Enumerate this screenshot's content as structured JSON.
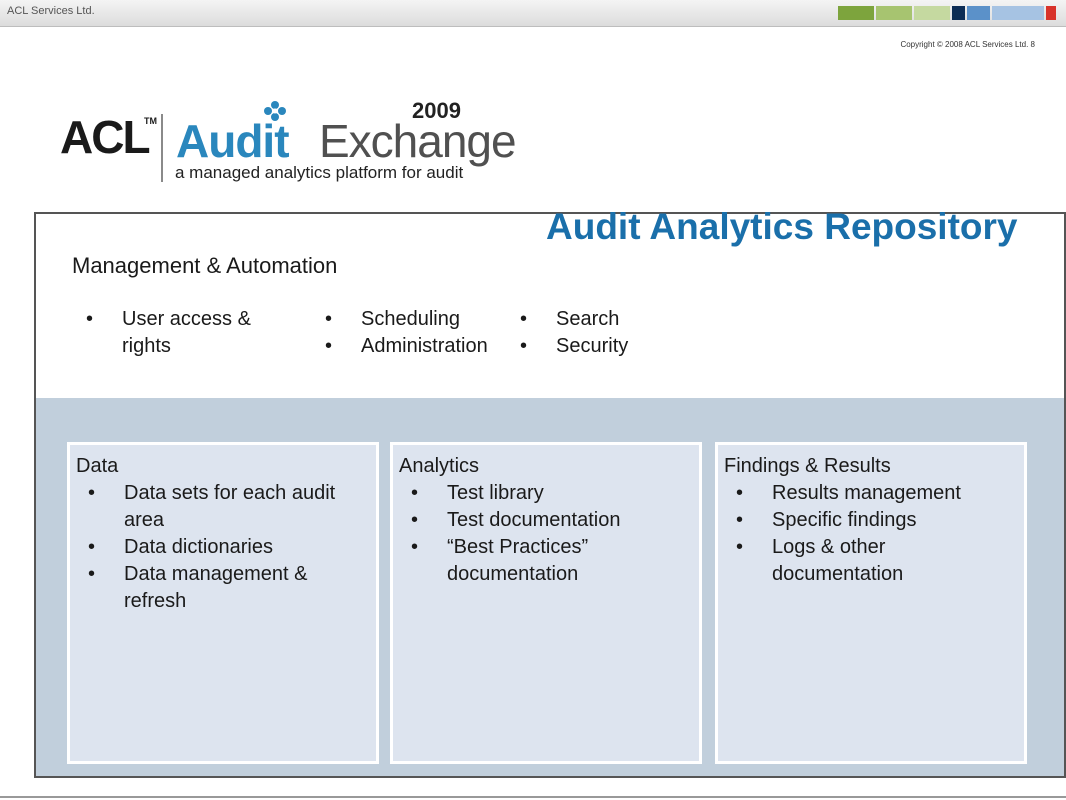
{
  "header": {
    "company": "ACL Services Ltd.",
    "copyright": "Copyright © 2008 ACL Services Ltd.  8",
    "swatch_colors": [
      "#7da43d",
      "#a7c470",
      "#c5d9a0",
      "#0d2d55",
      "#5b91c9",
      "#a6c3e3",
      "#d8332b"
    ]
  },
  "logo": {
    "brand": "ACL",
    "tm": "TM",
    "product_bold": "Audit",
    "product_light": "Exchange",
    "year": "2009",
    "tagline": "a managed analytics platform for audit"
  },
  "repository": {
    "title": "Audit Analytics Repository",
    "management": {
      "title": "Management & Automation",
      "columns": [
        [
          "User access & rights"
        ],
        [
          "Scheduling",
          "Administration"
        ],
        [
          "Search",
          "Security"
        ]
      ]
    },
    "boxes": [
      {
        "title": "Data",
        "items": [
          "Data sets for each audit area",
          "Data dictionaries",
          "Data management & refresh"
        ]
      },
      {
        "title": "Analytics",
        "items": [
          "Test library",
          "Test documentation",
          "“Best Practices” documentation"
        ]
      },
      {
        "title": "Findings & Results",
        "items": [
          "Results management",
          "Specific findings",
          "Logs & other documentation"
        ]
      }
    ]
  },
  "bullet_char": "•"
}
